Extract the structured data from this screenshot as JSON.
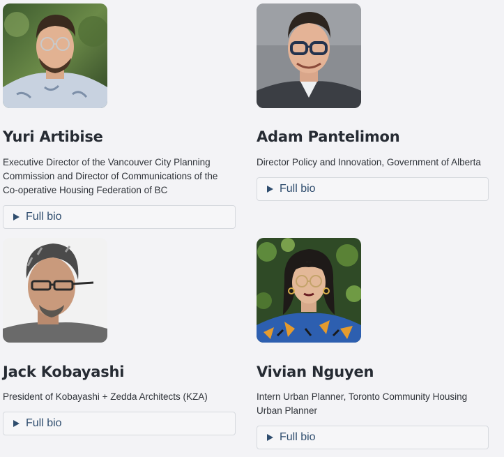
{
  "people": [
    {
      "name": "Yuri Artibise",
      "title": "Executive Director of the Vancouver City Planning Commission and Director of Communications of the Co-operative Housing Federation of BC",
      "bio_label": "Full bio"
    },
    {
      "name": "Adam Pantelimon",
      "title": "Director Policy and Innovation, Government of Alberta",
      "bio_label": "Full bio"
    },
    {
      "name": "Jack Kobayashi",
      "title": "President of Kobayashi + Zedda Architects (KZA)",
      "bio_label": "Full bio"
    },
    {
      "name": "Vivian Nguyen",
      "title": "Intern Urban Planner, Toronto Community Housing Urban Planner",
      "bio_label": "Full bio"
    }
  ],
  "colors": {
    "background": "#f3f3f6",
    "name_text": "#262b33",
    "link_text": "#2f4d6e",
    "button_border": "#d6d9de"
  },
  "icons": {
    "expand": "play-triangle-icon"
  }
}
